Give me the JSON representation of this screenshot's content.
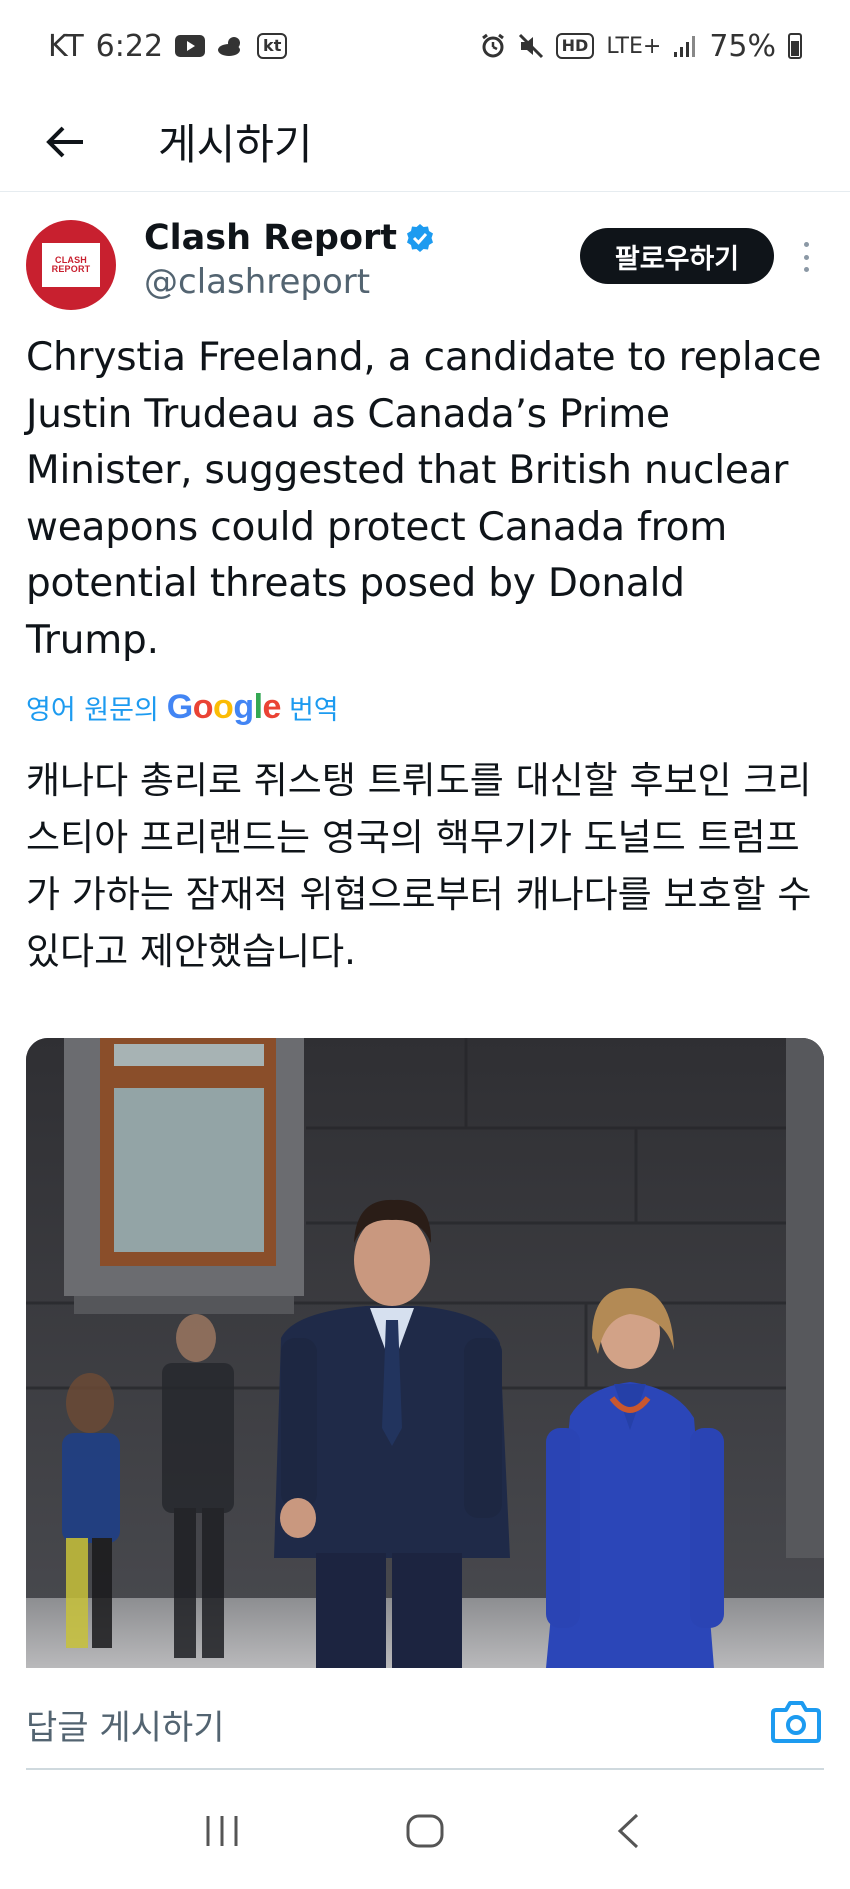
{
  "status_bar": {
    "carrier": "KT",
    "time": "6:22",
    "network": "LTE+",
    "battery": "75%"
  },
  "header": {
    "title": "게시하기"
  },
  "post": {
    "author": {
      "display_name": "Clash Report",
      "handle": "@clashreport",
      "avatar_text_top": "CLASH",
      "avatar_text_bottom": "REPORT"
    },
    "follow_label": "팔로우하기",
    "text": "Chrystia Freeland, a candidate to replace Justin Trudeau as Canada’s Prime Minister, suggested that British nuclear weapons could protect Canada from potential threats posed by Donald Trump.",
    "translate": {
      "prefix": "영어 원문의",
      "suffix": "번역"
    },
    "translated_text": "캐나다 총리로 쥐스탱 트뤼도를 대신할 후보인 크리스티아 프리랜드는 영국의 핵무기가 도널드 트럼프가 가하는 잠재적 위협으로부터 캐나다를 보호할 수 있다고 제안했습니다."
  },
  "reply_bar": {
    "placeholder": "답글 게시하기"
  },
  "colors": {
    "accent": "#1d9bf0",
    "verified": "#1d9bf0",
    "brand_red": "#c8202f"
  }
}
